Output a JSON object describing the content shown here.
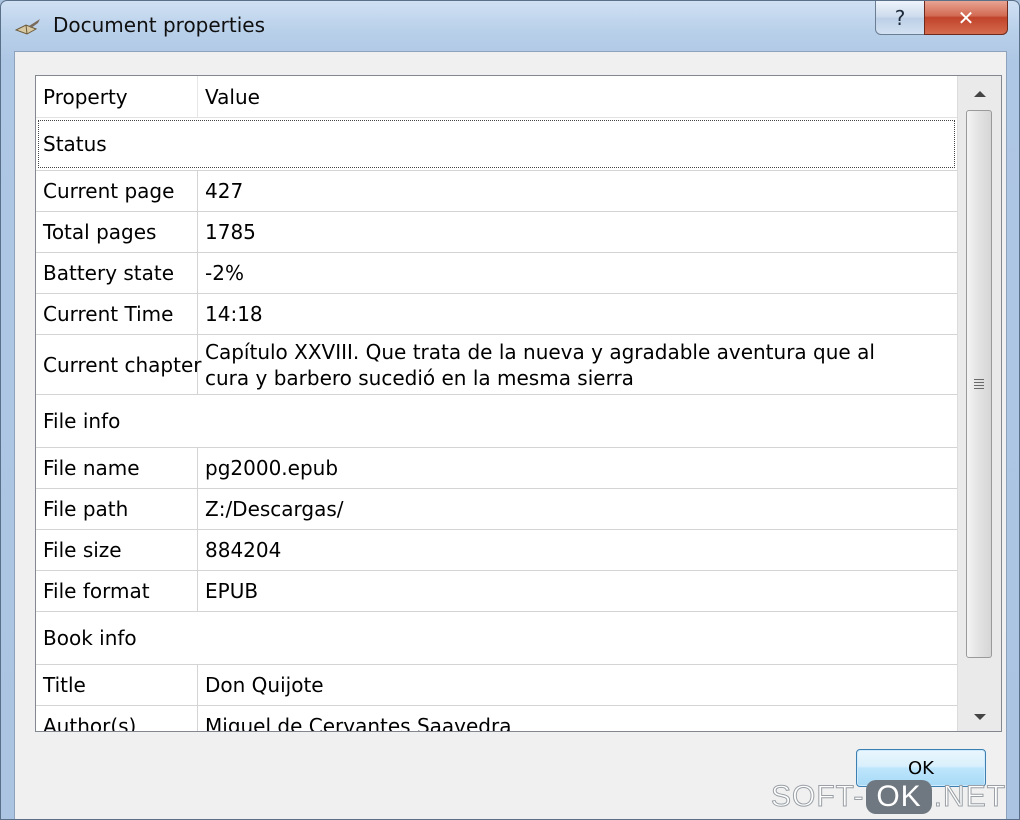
{
  "window": {
    "title": "Document properties"
  },
  "titlebar": {
    "help_label": "?",
    "close_label": "✕"
  },
  "table": {
    "header": {
      "property": "Property",
      "value": "Value"
    },
    "rows": [
      {
        "section": "Status"
      },
      {
        "property": "Current page",
        "value": "427"
      },
      {
        "property": "Total pages",
        "value": "1785"
      },
      {
        "property": "Battery state",
        "value": "-2%"
      },
      {
        "property": "Current Time",
        "value": "14:18"
      },
      {
        "property": "Current chapter",
        "value": "Capítulo XXVIII. Que trata de la nueva y agradable aventura que al cura y barbero sucedió en la mesma sierra"
      },
      {
        "section": "File info"
      },
      {
        "property": "File name",
        "value": "pg2000.epub"
      },
      {
        "property": "File path",
        "value": "Z:/Descargas/"
      },
      {
        "property": "File size",
        "value": "884204"
      },
      {
        "property": "File format",
        "value": "EPUB"
      },
      {
        "section": "Book info"
      },
      {
        "property": "Title",
        "value": "Don Quijote"
      },
      {
        "property": "Author(s)",
        "value": "Miguel de Cervantes Saavedra"
      }
    ]
  },
  "buttons": {
    "ok": "OK"
  },
  "watermark": {
    "left": "SOFT-",
    "mid": "OK",
    "right": ".NET"
  },
  "icons": {
    "app": "book-quill-icon",
    "scroll_up": "arrow-up-icon",
    "scroll_down": "arrow-down-icon",
    "scroll_grip": "grip-icon"
  },
  "colors": {
    "titlebar": "#b9d0ea",
    "close_button": "#c0432a",
    "ok_button_border": "#3c7fb1"
  }
}
